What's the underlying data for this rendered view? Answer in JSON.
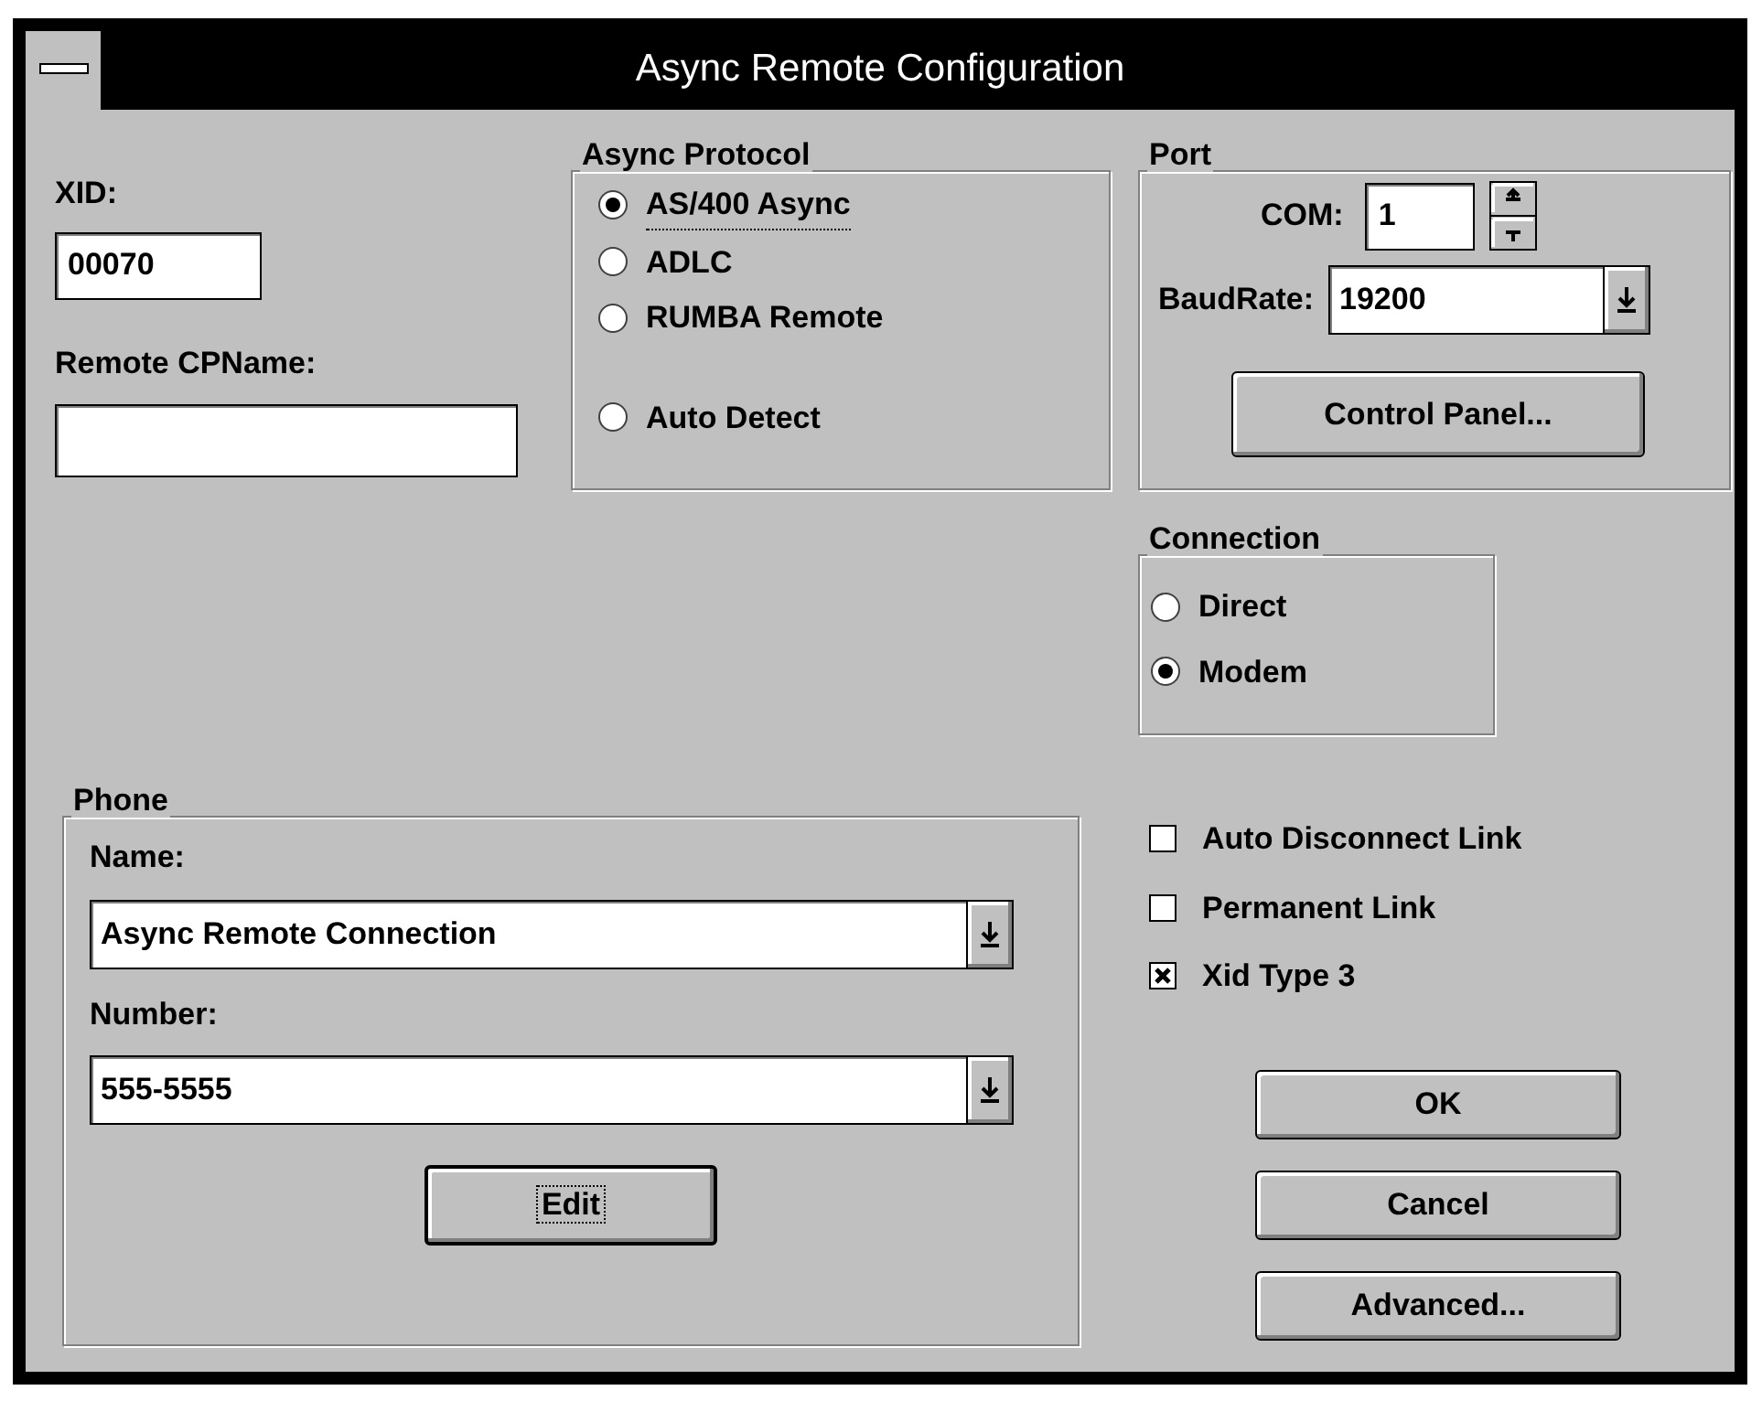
{
  "window": {
    "title": "Async Remote Configuration"
  },
  "xid": {
    "label": "XID:",
    "value": "00070"
  },
  "remote_cpname": {
    "label": "Remote CPName:"
  },
  "async_protocol": {
    "title": "Async Protocol",
    "options": [
      {
        "label": "AS/400 Async",
        "selected": true,
        "focused": true
      },
      {
        "label": "ADLC",
        "selected": false,
        "focused": false
      },
      {
        "label": "RUMBA Remote",
        "selected": false,
        "focused": false
      },
      {
        "label": "Auto Detect",
        "selected": false,
        "focused": false
      }
    ]
  },
  "port": {
    "title": "Port",
    "com": {
      "label": "COM:",
      "value": "1"
    },
    "baud_rate": {
      "label": "BaudRate:",
      "value": "19200"
    },
    "button": "Control Panel..."
  },
  "connection": {
    "title": "Connection",
    "options": [
      {
        "label": "Direct",
        "selected": false
      },
      {
        "label": "Modem",
        "selected": true
      }
    ]
  },
  "phone": {
    "title": "Phone",
    "name": {
      "label": "Name:",
      "value": "Async Remote Connection"
    },
    "number": {
      "label": "Number:",
      "value": "555-5555"
    },
    "edit_button": {
      "label": "Edit",
      "default": true,
      "focused": true
    }
  },
  "checkboxes": [
    {
      "label": "Auto Disconnect Link",
      "checked": false
    },
    {
      "label": "Permanent Link",
      "checked": false
    },
    {
      "label": "Xid Type 3",
      "checked": true
    }
  ],
  "buttons": [
    "OK",
    "Cancel",
    "Advanced..."
  ]
}
